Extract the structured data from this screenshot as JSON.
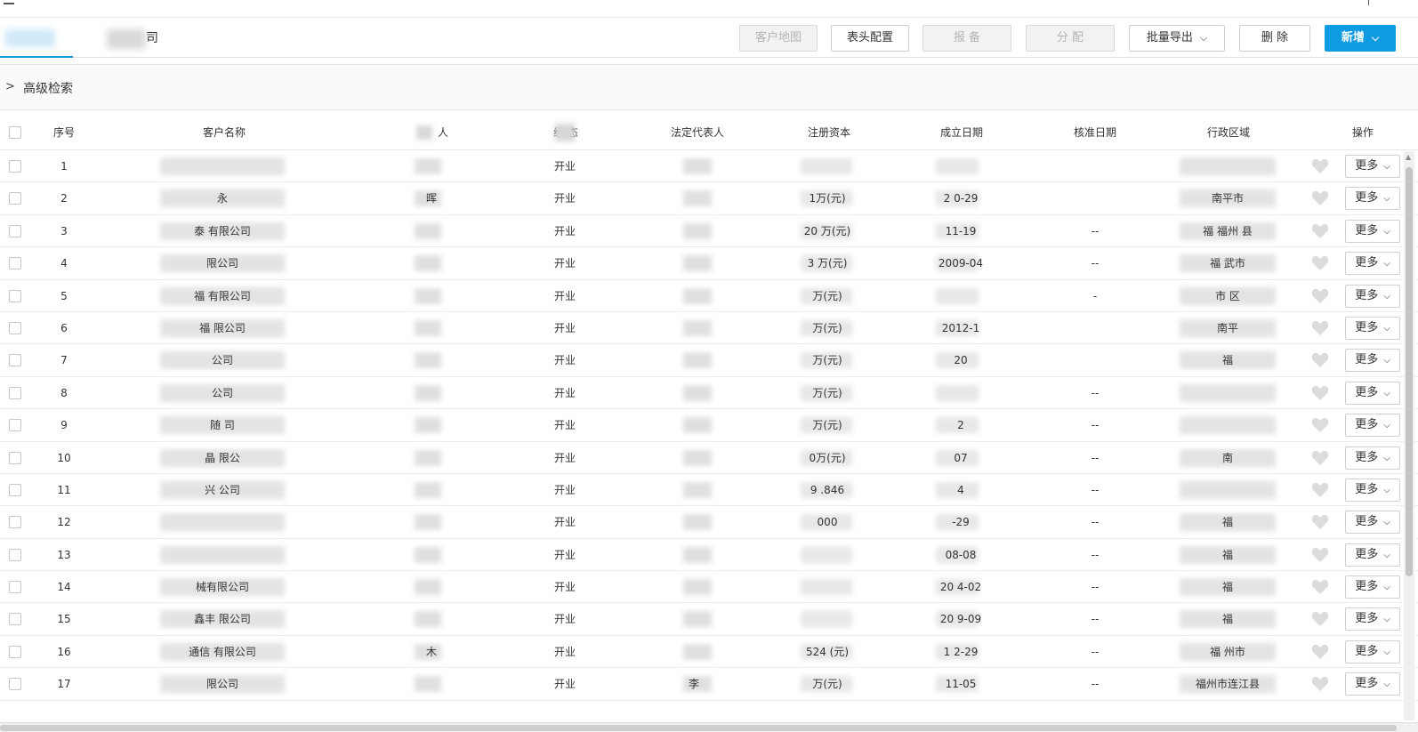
{
  "tabs": [
    {
      "label": ""
    },
    {
      "label": "司"
    }
  ],
  "toolbar": {
    "map": "客户地图",
    "header_config": "表头配置",
    "report": "报 备",
    "assign": "分 配",
    "export": "批量导出",
    "delete": "删 除",
    "add": "新增"
  },
  "advanced_search": "高级检索",
  "columns": [
    "序号",
    "客户名称",
    "人",
    "经 态",
    "法定代表人",
    "注册资本",
    "成立日期",
    "核准日期",
    "行政区域",
    "操作"
  ],
  "more_label": "更多",
  "rows": [
    {
      "no": "1",
      "name": "",
      "person": "",
      "status": "开业",
      "legal": "",
      "capital": "",
      "founded": "",
      "approved": "",
      "region": ""
    },
    {
      "no": "2",
      "name": "永",
      "person": "晖",
      "status": "开业",
      "legal": "",
      "capital": "1万(元)",
      "founded": "2 0-29",
      "approved": "",
      "region": "南平市"
    },
    {
      "no": "3",
      "name": "泰 有限公司",
      "person": "",
      "status": "开业",
      "legal": "",
      "capital": "20 万(元)",
      "founded": "11-19",
      "approved": "--",
      "region": "福 福州 县"
    },
    {
      "no": "4",
      "name": "限公司",
      "person": "",
      "status": "开业",
      "legal": "",
      "capital": "3 万(元)",
      "founded": "2009-04",
      "approved": "--",
      "region": "福 武市"
    },
    {
      "no": "5",
      "name": "福 有限公司",
      "person": "",
      "status": "开业",
      "legal": "",
      "capital": "万(元)",
      "founded": "",
      "approved": "-",
      "region": "市 区"
    },
    {
      "no": "6",
      "name": "福 限公司",
      "person": "",
      "status": "开业",
      "legal": "",
      "capital": "万(元)",
      "founded": "2012-1",
      "approved": "",
      "region": "南平"
    },
    {
      "no": "7",
      "name": "公司",
      "person": "",
      "status": "开业",
      "legal": "",
      "capital": "万(元)",
      "founded": "20",
      "approved": "",
      "region": "福"
    },
    {
      "no": "8",
      "name": "公司",
      "person": "",
      "status": "开业",
      "legal": "",
      "capital": "万(元)",
      "founded": "",
      "approved": "--",
      "region": ""
    },
    {
      "no": "9",
      "name": "随 司",
      "person": "",
      "status": "开业",
      "legal": "",
      "capital": "万(元)",
      "founded": "2",
      "approved": "--",
      "region": ""
    },
    {
      "no": "10",
      "name": "晶 限公",
      "person": "",
      "status": "开业",
      "legal": "",
      "capital": "0万(元)",
      "founded": "07",
      "approved": "--",
      "region": "南"
    },
    {
      "no": "11",
      "name": "兴 公司",
      "person": "",
      "status": "开业",
      "legal": "",
      "capital": "9 .846",
      "founded": "4",
      "approved": "--",
      "region": ""
    },
    {
      "no": "12",
      "name": "",
      "person": "",
      "status": "开业",
      "legal": "",
      "capital": "000",
      "founded": "-29",
      "approved": "--",
      "region": "福"
    },
    {
      "no": "13",
      "name": "",
      "person": "",
      "status": "开业",
      "legal": "",
      "capital": "",
      "founded": "08-08",
      "approved": "--",
      "region": "福"
    },
    {
      "no": "14",
      "name": "械有限公司",
      "person": "",
      "status": "开业",
      "legal": "",
      "capital": "",
      "founded": "20 4-02",
      "approved": "--",
      "region": "福"
    },
    {
      "no": "15",
      "name": "鑫丰 限公司",
      "person": "",
      "status": "开业",
      "legal": "",
      "capital": "",
      "founded": "20 9-09",
      "approved": "--",
      "region": "福"
    },
    {
      "no": "16",
      "name": "通信 有限公司",
      "person": "木",
      "status": "开业",
      "legal": "",
      "capital": "524 (元)",
      "founded": "1 2-29",
      "approved": "--",
      "region": "福 州市"
    },
    {
      "no": "17",
      "name": "限公司",
      "person": "",
      "status": "开业",
      "legal": "李",
      "capital": "万(元)",
      "founded": "11-05",
      "approved": "--",
      "region": "福州市连江县"
    }
  ]
}
